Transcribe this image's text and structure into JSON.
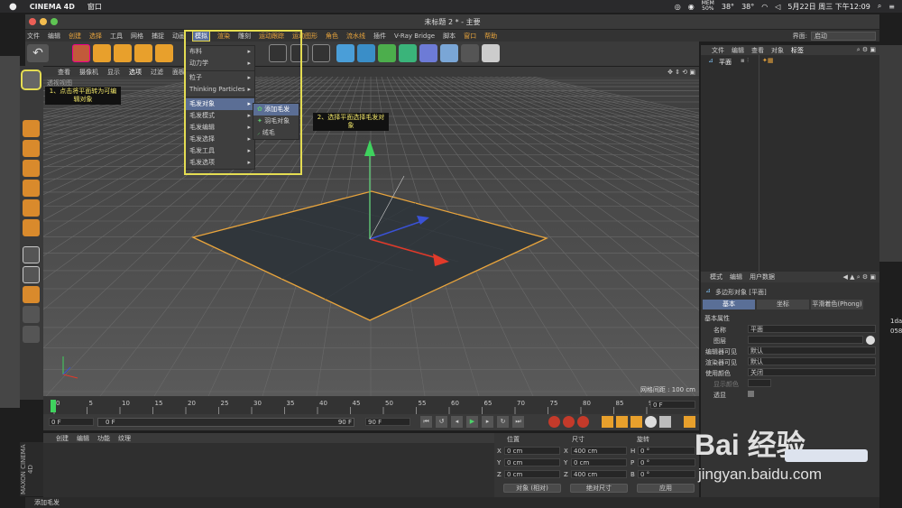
{
  "macos": {
    "app": "CINEMA 4D",
    "menu1": "窗口",
    "battery_label": "MEM",
    "battery_pct": "50%",
    "temp1": "38°",
    "temp2": "38°",
    "datetime": "5月22日 周三 下午12:09"
  },
  "window": {
    "title": "未标题 2 * - 主要"
  },
  "appmenu": {
    "items": [
      "文件",
      "编辑",
      "创建",
      "选择",
      "工具",
      "网格",
      "捕捉",
      "动画",
      "模拟",
      "渲染",
      "雕刻",
      "运动跟踪",
      "运动图形",
      "角色",
      "流水线",
      "插件",
      "V-Ray Bridge",
      "脚本",
      "窗口",
      "帮助"
    ],
    "layout_label": "界面:",
    "layout_value": "启动"
  },
  "viewport": {
    "menu": [
      "查看",
      "摄像机",
      "显示",
      "选项",
      "过滤",
      "面板"
    ],
    "view_name": "透视视图",
    "grid_info": "网格间距 : 100 cm"
  },
  "simulate_menu": {
    "items": [
      "布料",
      "动力学",
      "粒子",
      "Thinking Particles",
      "毛发对象",
      "毛发模式",
      "毛发编辑",
      "毛发选择",
      "毛发工具",
      "毛发选项"
    ]
  },
  "hair_submenu": {
    "items": [
      "添加毛发",
      "羽毛对象",
      "绒毛"
    ]
  },
  "callouts": {
    "step1": "1、点击将平面转为可编辑对象",
    "step2": "2、选择平面选择毛发对象"
  },
  "timeline": {
    "ticks": [
      "0",
      "5",
      "10",
      "15",
      "20",
      "25",
      "30",
      "35",
      "40",
      "45",
      "50",
      "55",
      "60",
      "65",
      "70",
      "75",
      "80",
      "85",
      "90"
    ],
    "end_frame": "0 F",
    "current": "0 F",
    "range_start": "0 F",
    "range_end": "90 F",
    "range_end2": "90 F"
  },
  "material": {
    "menu": [
      "创建",
      "编辑",
      "功能",
      "纹理"
    ]
  },
  "coords": {
    "headers": [
      "位置",
      "尺寸",
      "旋转"
    ],
    "rows": [
      {
        "axis": "X",
        "pos": "0 cm",
        "size": "400 cm",
        "rot_axis": "H",
        "rot": "0 °"
      },
      {
        "axis": "Y",
        "pos": "0 cm",
        "size": "0 cm",
        "rot_axis": "P",
        "rot": "0 °"
      },
      {
        "axis": "Z",
        "pos": "0 cm",
        "size": "400 cm",
        "rot_axis": "B",
        "rot": "0 °"
      }
    ],
    "mode1": "对象 (相对)",
    "mode2": "绝对尺寸",
    "apply": "应用"
  },
  "objects": {
    "menu": [
      "文件",
      "编辑",
      "查看",
      "对象",
      "标签"
    ],
    "item": "平面"
  },
  "attributes": {
    "menu": [
      "模式",
      "编辑",
      "用户数据"
    ],
    "title": "多边形对象 [平面]",
    "tabs": [
      "基本",
      "坐标",
      "平滑着色(Phong)"
    ],
    "section": "基本属性",
    "fields": [
      {
        "label": "名称",
        "value": "平面"
      },
      {
        "label": "图层",
        "value": ""
      },
      {
        "label": "编辑器可见",
        "value": "默认"
      },
      {
        "label": "渲染器可见",
        "value": "默认"
      },
      {
        "label": "使用颜色",
        "value": "关闭"
      },
      {
        "label": "显示颜色",
        "value": ""
      },
      {
        "label": "透显",
        "value": ""
      }
    ]
  },
  "status": "添加毛发",
  "watermark": {
    "brand": "Bai 经验",
    "url": "jingyan.baidu.com"
  },
  "side_numbers": [
    "1da",
    "058"
  ]
}
